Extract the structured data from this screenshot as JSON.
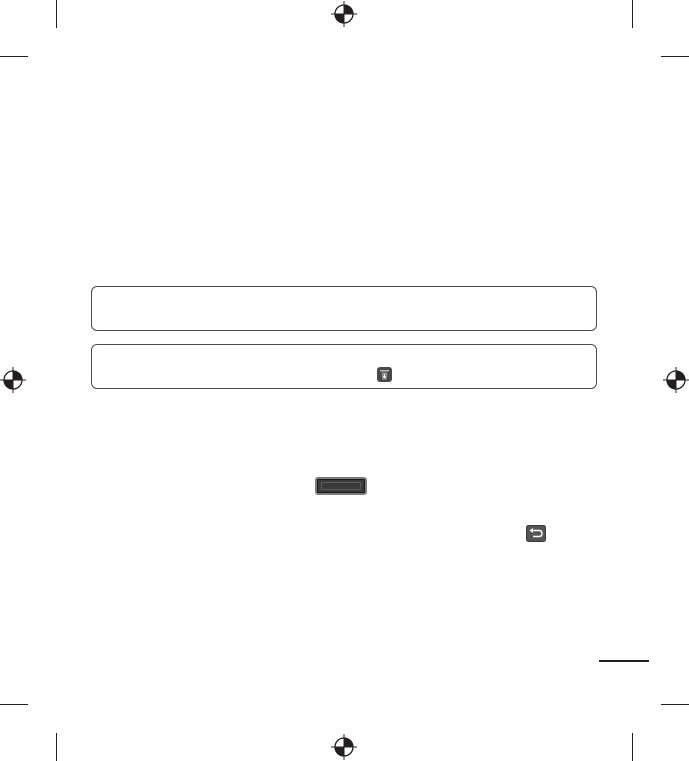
{
  "page": {
    "background": "#ffffff",
    "ink_color": "#231f20"
  },
  "notes": [
    {
      "text": ""
    },
    {
      "text": "",
      "icon": "trash-icon"
    }
  ],
  "icons": {
    "inline_trash": "trash-icon",
    "inline_menu_key": "menu-key-graphic",
    "inline_back_key": "back-arrow-icon",
    "registration_mark": "registration-target-icon"
  }
}
